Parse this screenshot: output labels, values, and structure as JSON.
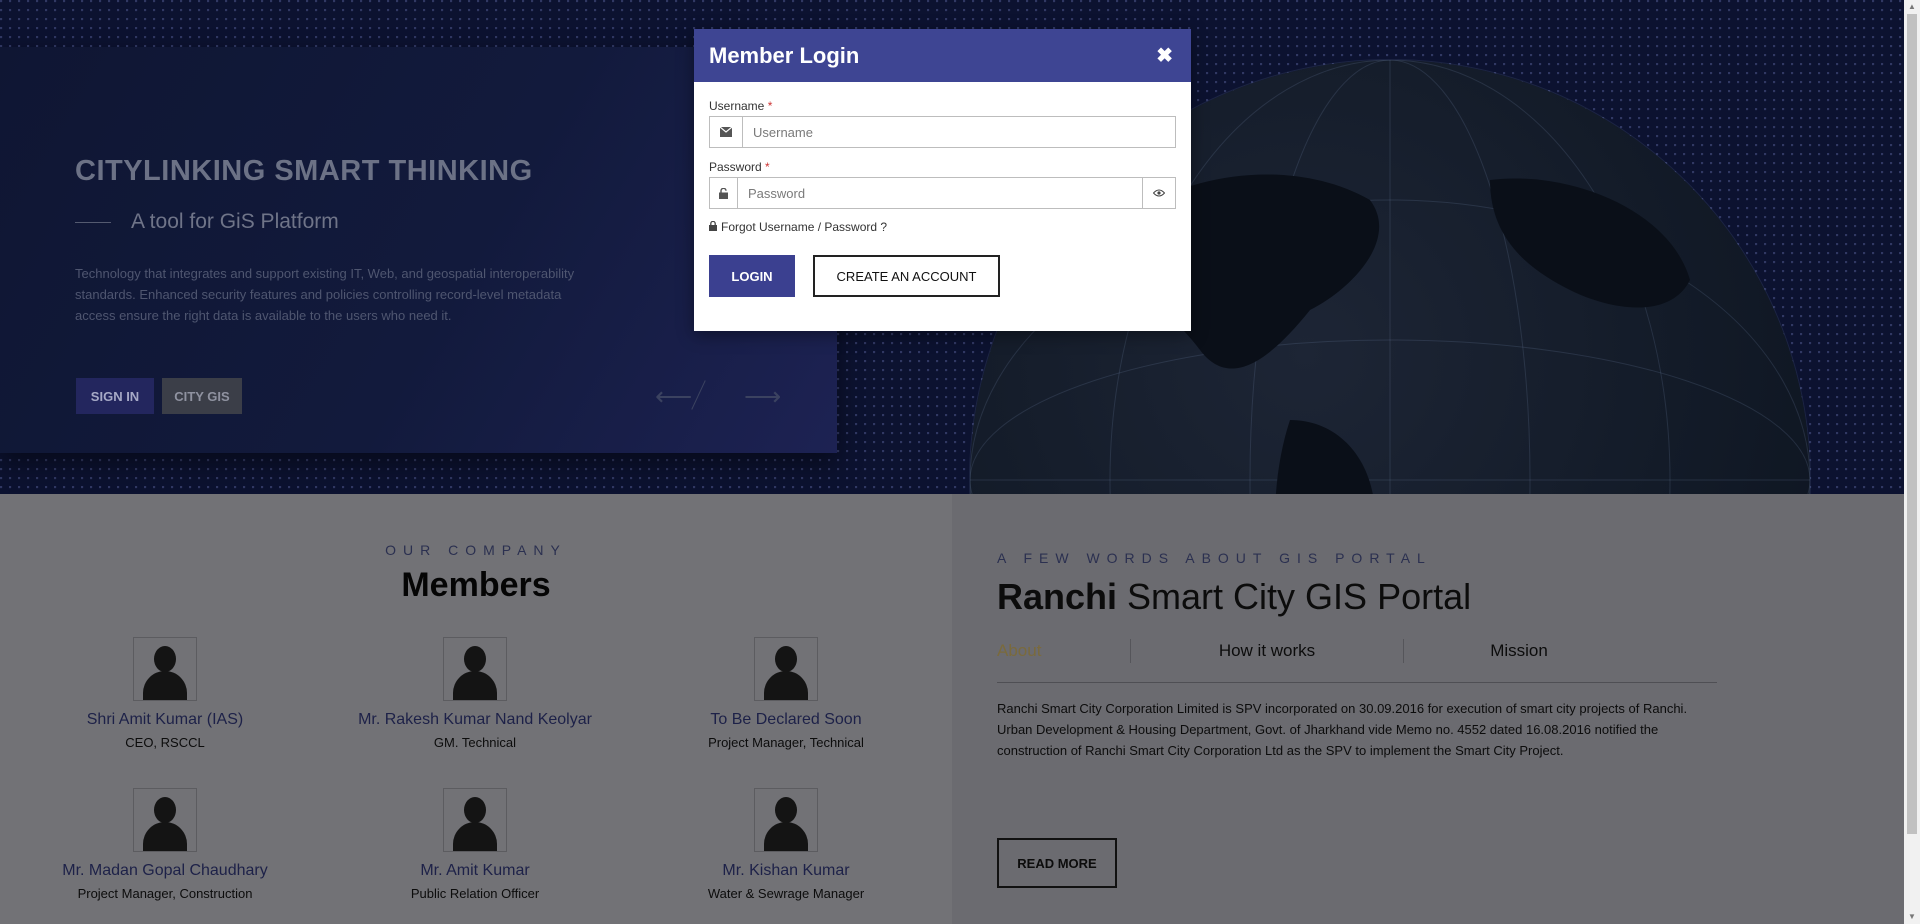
{
  "hero": {
    "title": "CITYLINKING SMART THINKING",
    "subtitle": "A tool for GiS Platform",
    "description": "Technology that integrates and support existing IT, Web, and geospatial interoperability standards. Enhanced security features and policies controlling record-level metadata access ensure the right data is available to the users who need it.",
    "sign_in_label": "SIGN IN",
    "city_gis_label": "CITY GIS",
    "prev_arrow": "⟵",
    "next_arrow": "⟶"
  },
  "modal": {
    "title": "Member Login",
    "close_glyph": "✖",
    "username_label": "Username",
    "username_placeholder": "Username",
    "username_value": "",
    "password_label": "Password",
    "password_placeholder": "Password",
    "password_value": "",
    "required_mark": "*",
    "forgot_text": "Forgot Username / Password ?",
    "login_label": "LOGIN",
    "create_label": "CREATE AN ACCOUNT",
    "accent_color": "#3e4593"
  },
  "members": {
    "eyebrow": "OUR COMPANY",
    "title": "Members",
    "items": [
      {
        "name": "Shri Amit Kumar (IAS)",
        "role": "CEO, RSCCL"
      },
      {
        "name": "Mr. Rakesh Kumar Nand Keolyar",
        "role": "GM. Technical"
      },
      {
        "name": "To Be Declared Soon",
        "role": "Project Manager, Technical"
      },
      {
        "name": "Mr. Madan Gopal Chaudhary",
        "role": "Project Manager, Construction"
      },
      {
        "name": "Mr. Amit Kumar",
        "role": "Public Relation Officer"
      },
      {
        "name": "Mr. Kishan Kumar",
        "role": "Water & Sewrage Manager"
      }
    ]
  },
  "about": {
    "eyebrow": "A FEW WORDS ABOUT GIS PORTAL",
    "title_bold": "Ranchi",
    "title_rest": " Smart City GIS Portal",
    "tabs": [
      "About",
      "How it works",
      "Mission"
    ],
    "text": "Ranchi Smart City Corporation Limited is SPV incorporated on 30.09.2016 for execution of smart city projects of Ranchi. Urban Development & Housing Department, Govt. of Jharkhand vide Memo no. 4552 dated 16.08.2016 notified the construction of Ranchi Smart City Corporation Ltd as the SPV to implement the Smart City Project.",
    "read_more_label": "READ MORE"
  }
}
